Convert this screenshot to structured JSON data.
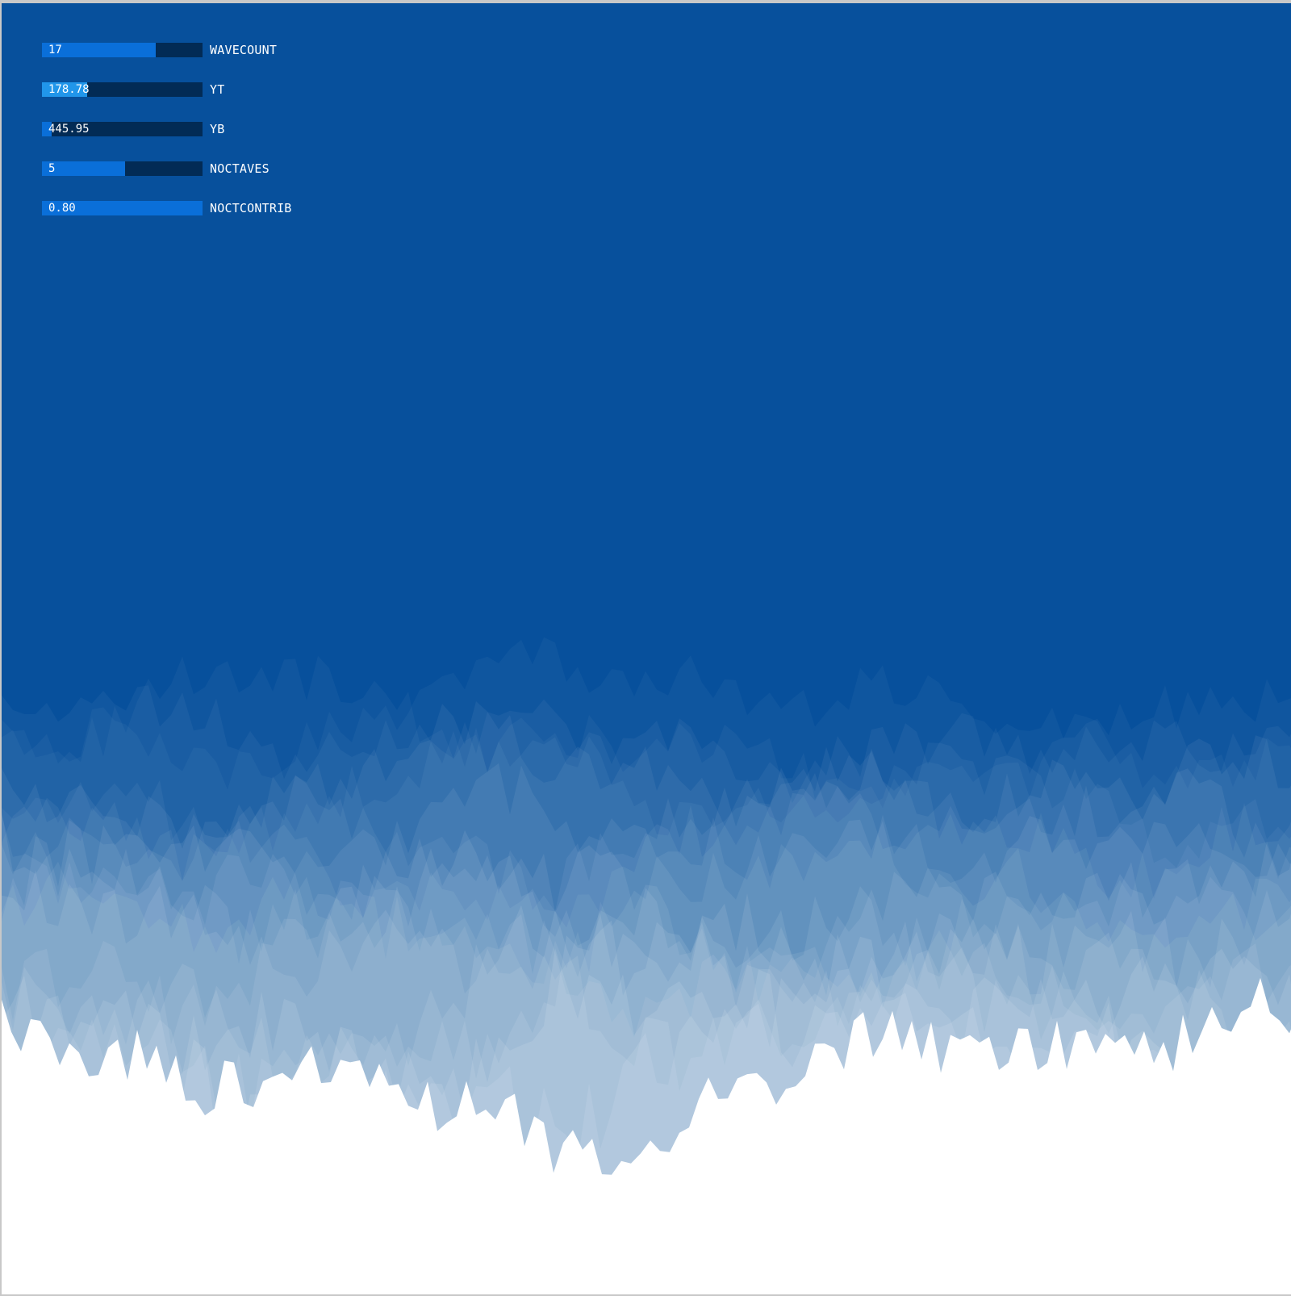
{
  "colors": {
    "sky": "#07509c",
    "terrain_layer": "#ffffff",
    "slider_track": "#022b55",
    "slider_fill": "#0a6fd9",
    "slider_fill_active": "#2196ea",
    "text": "#ffffff",
    "window_frame": "#c8c8c8"
  },
  "controls": [
    {
      "label": "WAVECOUNT",
      "value": "17",
      "fraction": 0.71,
      "active": false
    },
    {
      "label": "YT",
      "value": "178.78",
      "fraction": 0.28,
      "active": true
    },
    {
      "label": "YB",
      "value": "445.95",
      "fraction": 0.06,
      "active": false
    },
    {
      "label": "NOCTAVES",
      "value": "5",
      "fraction": 0.52,
      "active": false
    },
    {
      "label": "NOCTCONTRIB",
      "value": "0.80",
      "fraction": 1.0,
      "active": false
    }
  ],
  "terrain": {
    "layer_count": 17,
    "noctaves": 5,
    "noct_contrib": 0.8
  }
}
